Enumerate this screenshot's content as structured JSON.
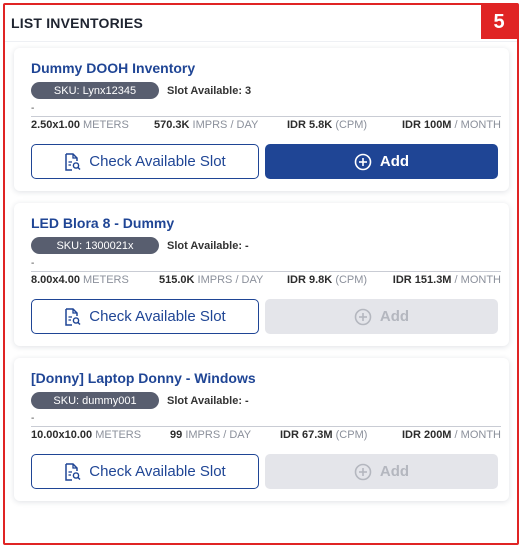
{
  "panel": {
    "title": "LIST INVENTORIES",
    "badge": "5"
  },
  "cards": [
    {
      "title": "Dummy DOOH Inventory",
      "sku": "SKU: Lynx12345",
      "slot": "Slot Available: 3",
      "dash": "-",
      "size_value": "2.50x1.00",
      "size_unit": "METERS",
      "imprs_value": "570.3K",
      "imprs_unit": "IMPRS / DAY",
      "cpm_value": "IDR 5.8K",
      "cpm_unit": "(CPM)",
      "month_value": "IDR 100M",
      "month_unit": "/ MONTH",
      "check_label": "Check Available Slot",
      "add_label": "Add",
      "add_enabled": true
    },
    {
      "title": "LED Blora 8 - Dummy",
      "sku": "SKU: 1300021x",
      "slot": "Slot Available: -",
      "dash": "-",
      "size_value": "8.00x4.00",
      "size_unit": "METERS",
      "imprs_value": "515.0K",
      "imprs_unit": "IMPRS / DAY",
      "cpm_value": "IDR 9.8K",
      "cpm_unit": "(CPM)",
      "month_value": "IDR 151.3M",
      "month_unit": "/ MONTH",
      "check_label": "Check Available Slot",
      "add_label": "Add",
      "add_enabled": false
    },
    {
      "title": "[Donny] Laptop Donny - Windows",
      "sku": "SKU: dummy001",
      "slot": "Slot Available: -",
      "dash": "-",
      "size_value": "10.00x10.00",
      "size_unit": "METERS",
      "imprs_value": "99",
      "imprs_unit": "IMPRS / DAY",
      "cpm_value": "IDR 67.3M",
      "cpm_unit": "(CPM)",
      "month_value": "IDR 200M",
      "month_unit": "/ MONTH",
      "check_label": "Check Available Slot",
      "add_label": "Add",
      "add_enabled": false
    }
  ],
  "colors": {
    "accent": "#1f4595",
    "badge": "#e02424",
    "sku_pill": "#585e6f",
    "disabled_button": "#e4e5ea"
  },
  "icons": {
    "check": "document-search-icon",
    "add": "plus-circle-icon"
  }
}
